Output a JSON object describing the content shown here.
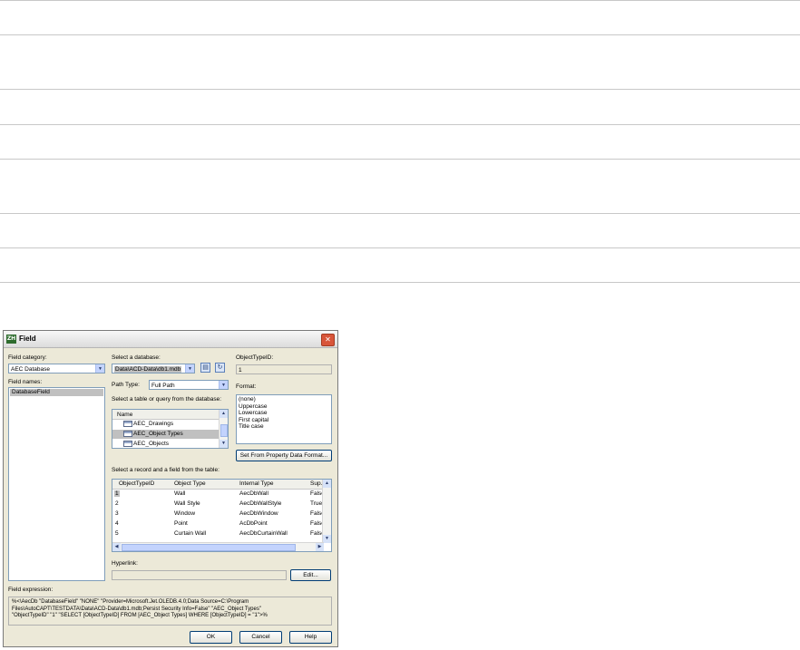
{
  "dialog": {
    "title": "Field",
    "app_icon_text": "ZH",
    "field_category": {
      "label": "Field category:",
      "value": "AEC Database"
    },
    "field_names": {
      "label": "Field names:",
      "items": [
        "DatabaseField"
      ]
    },
    "database": {
      "label": "Select a database:",
      "value": "Data\\ACD-Data\\db1.mdb"
    },
    "path_type": {
      "label": "Path Type:",
      "value": "Full Path"
    },
    "objecttypeid": {
      "label": "ObjectTypeID:",
      "value": "1"
    },
    "format": {
      "label": "Format:",
      "options": [
        "(none)",
        "Uppercase",
        "Lowercase",
        "First capital",
        "Title case"
      ]
    },
    "table_select": {
      "label": "Select a table or query from the database:",
      "header": "Name",
      "items": [
        "AEC_Drawings",
        "AEC_Object Types",
        "AEC_Objects"
      ]
    },
    "set_format_button": "Set From Property Data Format...",
    "record_select": {
      "label": "Select a record and a field from the table:",
      "columns": [
        "ObjectTypeID",
        "Object Type",
        "Internal Type",
        "Sup..."
      ],
      "rows": [
        [
          "1",
          "Wall",
          "AecDbWall",
          "False"
        ],
        [
          "2",
          "Wall Style",
          "AecDbWallStyle",
          "True"
        ],
        [
          "3",
          "Window",
          "AecDbWindow",
          "False"
        ],
        [
          "4",
          "Point",
          "AcDbPoint",
          "False"
        ],
        [
          "5",
          "Curtain Wall",
          "AecDbCurtainWall",
          "False"
        ]
      ]
    },
    "hyperlink": {
      "label": "Hyperlink:",
      "value": ""
    },
    "edit_button": "Edit...",
    "field_expression": {
      "label": "Field expression:",
      "lines": [
        "%<\\AecDb \"DatabaseField\" \"NONE\" \"Provider=Microsoft.Jet.OLEDB.4.0;Data Source=C:\\Program",
        "Files\\AutoCAPT\\TESTDATA\\Data\\ACD-Data\\db1.mdb;Persist Security Info=False\" \"AEC_Object Types\"",
        "\"ObjectTypeID\" \"1\" \"SELECT [ObjectTypeID] FROM [AEC_Object Types] WHERE [ObjectTypeID] = \"1\">%"
      ]
    },
    "buttons": {
      "ok": "OK",
      "cancel": "Cancel",
      "help": "Help"
    }
  }
}
